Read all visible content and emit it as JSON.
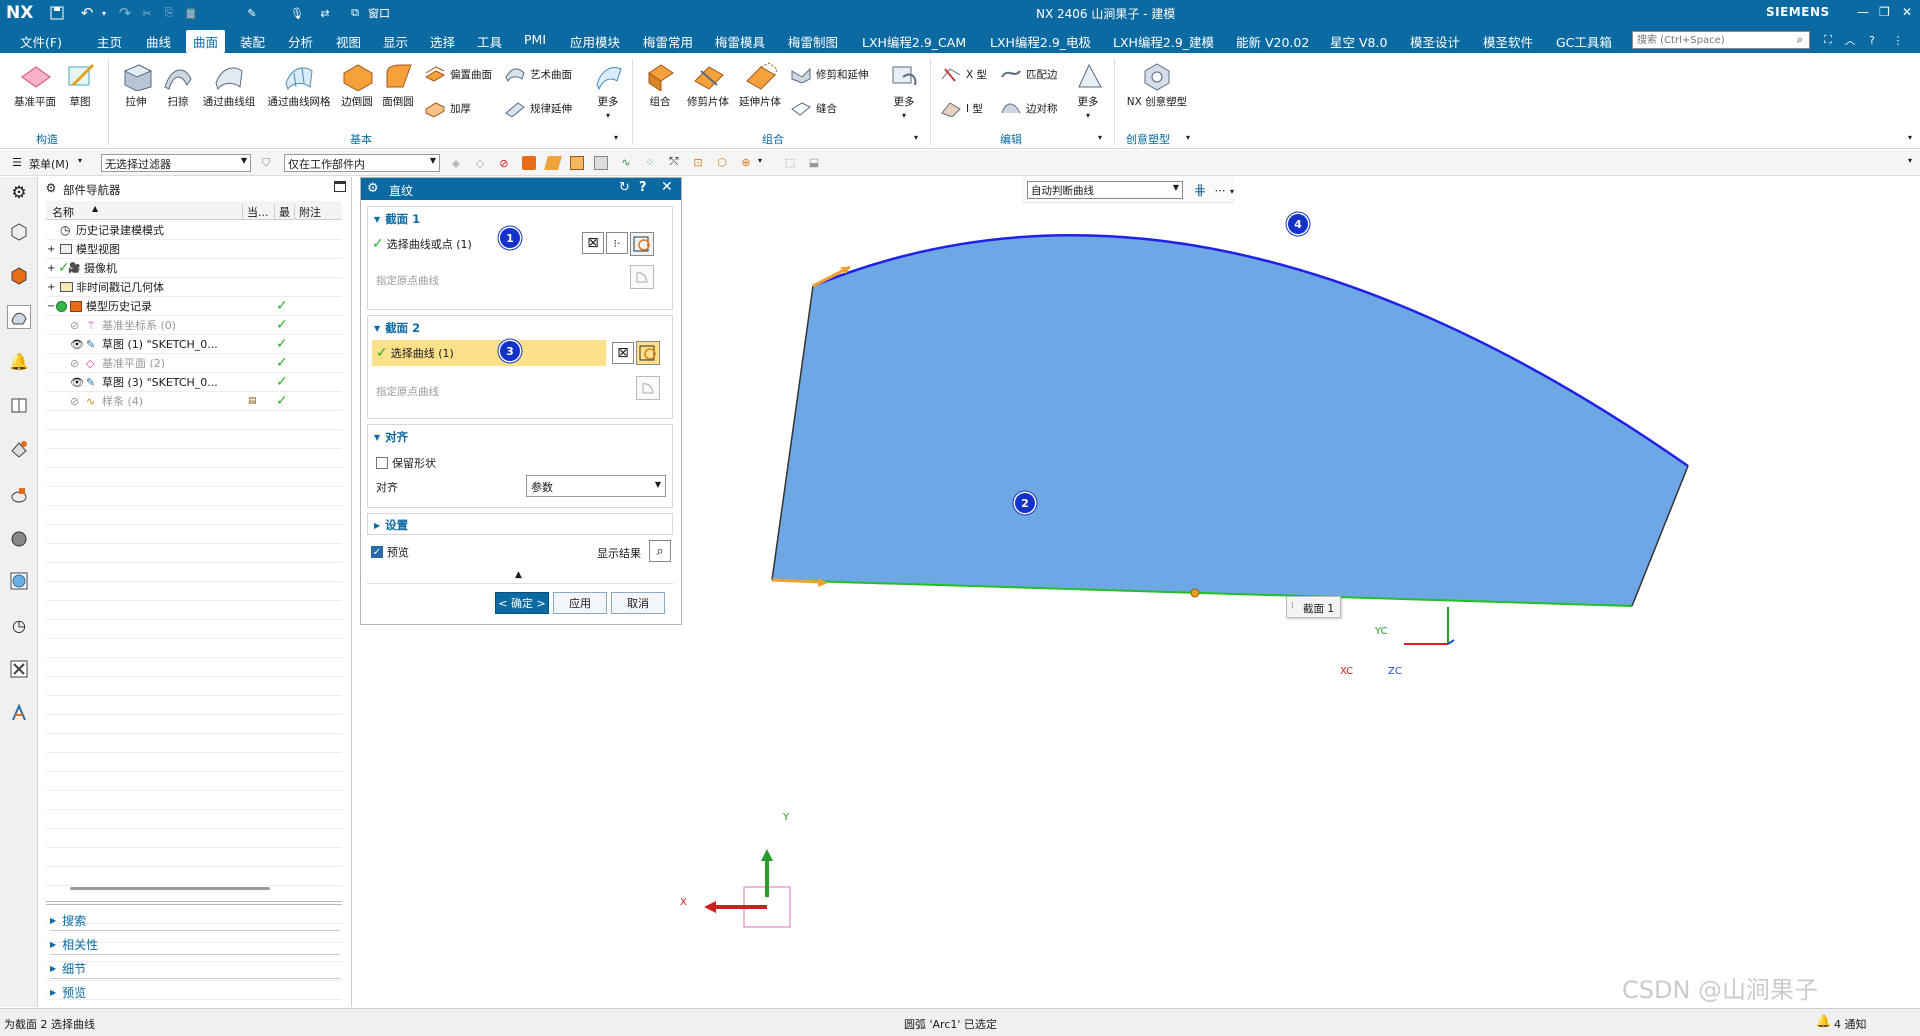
{
  "app": {
    "logo": "NX",
    "title": "NX 2406 山涧果子 - 建模",
    "brand": "SIEMENS",
    "window_menu": "窗口"
  },
  "menubar": {
    "items": [
      "文件(F)",
      "主页",
      "曲线",
      "曲面",
      "装配",
      "分析",
      "视图",
      "显示",
      "选择",
      "工具",
      "PMI",
      "应用模块",
      "梅雷常用",
      "梅雷模具",
      "梅雷制图",
      "LXH编程2.9_CAM",
      "LXH编程2.9_电极",
      "LXH编程2.9_建模",
      "能新 V20.02",
      "星空 V8.0",
      "模圣设计",
      "模圣软件",
      "GC工具箱"
    ],
    "active": "曲面",
    "search_placeholder": "搜索 (Ctrl+Space)"
  },
  "ribbon": {
    "construct": {
      "items": [
        "基准平面",
        "草图"
      ],
      "label": "构造"
    },
    "basic": {
      "items": [
        "拉伸",
        "扫掠",
        "通过曲线组",
        "通过曲线网格",
        "边倒圆",
        "面倒圆"
      ],
      "small": [
        "偏置曲面",
        "艺术曲面",
        "加厚",
        "规律延伸"
      ],
      "more": "更多",
      "label": "基本"
    },
    "combine": {
      "items": [
        "组合",
        "修剪片体",
        "延伸片体"
      ],
      "small": [
        "修剪和延伸",
        "缝合"
      ],
      "more": "更多",
      "label": "组合"
    },
    "edit": {
      "small": [
        "X 型",
        "匹配边",
        "I 型",
        "边对称"
      ],
      "more": "更多",
      "label": "编辑"
    },
    "creative": {
      "items": [
        "NX 创意塑型"
      ],
      "label": "创意塑型"
    }
  },
  "selection_bar": {
    "menu": "菜单(M)",
    "filter": "无选择过滤器",
    "scope": "仅在工作部件内"
  },
  "navigator": {
    "title": "部件导航器",
    "columns": [
      "名称",
      "当...",
      "最",
      "附注"
    ],
    "rows": [
      {
        "label": "历史记录建模模式",
        "check": false,
        "grey": false
      },
      {
        "label": "模型视图",
        "check": false,
        "grey": false
      },
      {
        "label": "摄像机",
        "check": false,
        "grey": false
      },
      {
        "label": "非时间戳记几何体",
        "check": false,
        "grey": false
      },
      {
        "label": "模型历史记录",
        "check": true,
        "grey": false
      },
      {
        "label": "基准坐标系 (0)",
        "check": true,
        "grey": true
      },
      {
        "label": "草图 (1) \"SKETCH_0...",
        "check": true,
        "grey": false
      },
      {
        "label": "基准平面 (2)",
        "check": true,
        "grey": true
      },
      {
        "label": "草图 (3) \"SKETCH_0...",
        "check": true,
        "grey": false
      },
      {
        "label": "样条 (4)",
        "check": true,
        "grey": true
      }
    ],
    "sections": [
      "搜索",
      "相关性",
      "细节",
      "预览"
    ]
  },
  "dialog": {
    "title": "直纹",
    "section1": {
      "header": "截面 1",
      "select": "选择曲线或点 (1)",
      "origin": "指定原点曲线",
      "badge": "1"
    },
    "section2": {
      "header": "截面 2",
      "select": "选择曲线 (1)",
      "origin": "指定原点曲线",
      "badge": "3"
    },
    "align": {
      "header": "对齐",
      "keep_shape": "保留形状",
      "align_label": "对齐",
      "align_value": "参数"
    },
    "settings": {
      "header": "设置"
    },
    "preview": {
      "label": "预览",
      "show_result": "显示结果"
    },
    "buttons": {
      "ok": "< 确定 >",
      "apply": "应用",
      "cancel": "取消"
    }
  },
  "graphics": {
    "curve_rule": "自动判断曲线",
    "badges": [
      "2",
      "4"
    ],
    "section_label": "截面 1",
    "wcs": {
      "x": "XC",
      "y": "YC",
      "z": "ZC"
    },
    "triad": {
      "x": "X",
      "y": "Y"
    }
  },
  "status": {
    "left": "为截面 2 选择曲线",
    "center": "圆弧 'Arc1' 已选定",
    "notify": "4 通知"
  },
  "watermark": "CSDN @山涧果子",
  "colors": {
    "accent": "#0b6aa2",
    "surface": "#6ea8e4",
    "arc": "#2020e6",
    "line": "#22c022",
    "highlight": "#fde08a"
  }
}
